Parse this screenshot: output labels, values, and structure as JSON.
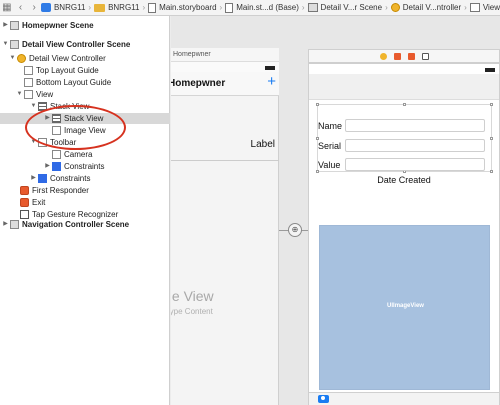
{
  "jumpbar": {
    "crumbs": [
      {
        "label": "BNRG11",
        "icon": "swift-project-icon"
      },
      {
        "label": "BNRG11",
        "icon": "folder-icon"
      },
      {
        "label": "Main.storyboard",
        "icon": "storyboard-file-icon"
      },
      {
        "label": "Main.st...d (Base)",
        "icon": "storyboard-file-icon"
      },
      {
        "label": "Detail V...r Scene",
        "icon": "scene-icon"
      },
      {
        "label": "Detail V...ntroller",
        "icon": "view-controller-icon"
      },
      {
        "label": "View",
        "icon": "view-icon"
      }
    ]
  },
  "outline": {
    "items": [
      {
        "label": "Homepwner Scene",
        "bold": true
      },
      {
        "label": "Detail View Controller Scene",
        "bold": true
      },
      {
        "label": "Detail View Controller"
      },
      {
        "label": "Top Layout Guide"
      },
      {
        "label": "Bottom Layout Guide"
      },
      {
        "label": "View"
      },
      {
        "label": "Stack View"
      },
      {
        "label": "Stack View"
      },
      {
        "label": "Image View"
      },
      {
        "label": "Toolbar"
      },
      {
        "label": "Camera"
      },
      {
        "label": "Constraints"
      },
      {
        "label": "Constraints"
      },
      {
        "label": "First Responder"
      },
      {
        "label": "Exit"
      },
      {
        "label": "Tap Gesture Recognizer"
      },
      {
        "label": "Navigation Controller Scene",
        "bold": true
      }
    ],
    "selected_index": 7
  },
  "canvas": {
    "left_scene": {
      "title": "Homepwner",
      "nav_title": "Homepwner",
      "add_symbol": "+",
      "cell_label": "Label",
      "table_title": "ble View",
      "table_subtitle": "otype Content"
    },
    "segue_icon": "⊕",
    "detail_scene": {
      "fields": [
        {
          "label": "Name"
        },
        {
          "label": "Serial"
        },
        {
          "label": "Value"
        }
      ],
      "date_label": "Date Created",
      "image_view_label": "UIImageView"
    }
  }
}
